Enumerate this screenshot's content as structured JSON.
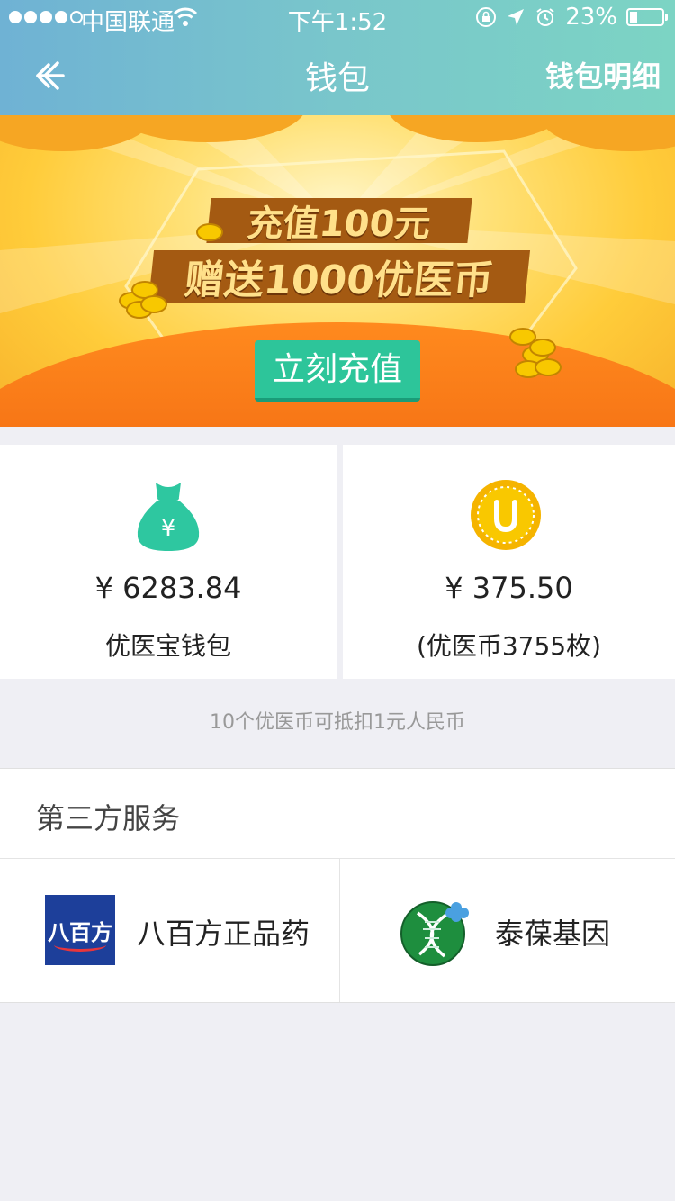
{
  "status_bar": {
    "carrier": "中国联通",
    "time": "下午1:52",
    "battery": "23%",
    "battery_level": 0.23
  },
  "nav": {
    "title": "钱包",
    "right_action": "钱包明细",
    "back_icon": "back-arrow-icon"
  },
  "banner": {
    "line1": "充值100元",
    "line2": "赠送1000优医币",
    "cta": "立刻充值"
  },
  "wallets": [
    {
      "amount": "¥ 6283.84",
      "label": "优医宝钱包",
      "icon": "money-bag-icon",
      "color": "#2ec7a0"
    },
    {
      "amount": "¥ 375.50",
      "label": "(优医币3755枚)",
      "icon": "coin-icon",
      "color": "#f5b400"
    }
  ],
  "note": "10个优医币可抵扣1元人民币",
  "services": {
    "title": "第三方服务",
    "items": [
      {
        "name": "八百方正品药",
        "logo_text": "八百方"
      },
      {
        "name": "泰葆基因"
      }
    ]
  }
}
